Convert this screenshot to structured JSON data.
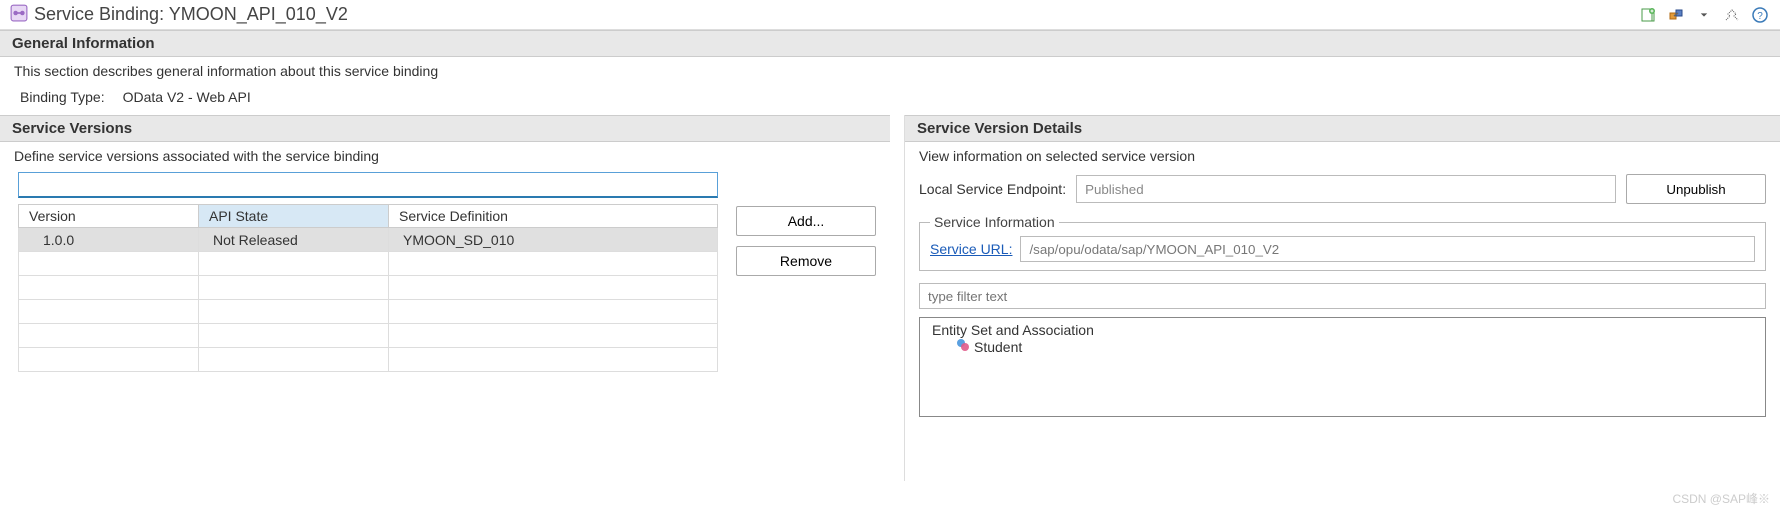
{
  "header": {
    "title": "Service Binding: YMOON_API_010_V2"
  },
  "toolbar": {
    "icons": [
      "new-icon",
      "link-icon",
      "dropdown-icon",
      "breadcrumb-icon",
      "help-icon"
    ]
  },
  "general": {
    "section_title": "General Information",
    "description": "This section describes general information about this service binding",
    "binding_type_label": "Binding Type:",
    "binding_type_value": "OData V2 - Web API"
  },
  "service_versions": {
    "section_title": "Service Versions",
    "description": "Define service versions associated with the service binding",
    "search_value": "",
    "columns": {
      "version": "Version",
      "api_state": "API State",
      "service_def": "Service Definition"
    },
    "rows": [
      {
        "version": "1.0.0",
        "api_state": "Not Released",
        "service_def": "YMOON_SD_010"
      }
    ],
    "add_label": "Add...",
    "remove_label": "Remove"
  },
  "version_details": {
    "section_title": "Service Version Details",
    "description": "View information on selected service version",
    "local_endpoint_label": "Local Service Endpoint:",
    "local_endpoint_value": "Published",
    "unpublish_label": "Unpublish",
    "service_info_legend": "Service Information",
    "service_url_label": "Service URL:",
    "service_url_value": "/sap/opu/odata/sap/YMOON_API_010_V2",
    "filter_placeholder": "type filter text",
    "entity_root": "Entity Set and Association",
    "entities": [
      "Student"
    ]
  },
  "watermark": "CSDN @SAP峰※"
}
